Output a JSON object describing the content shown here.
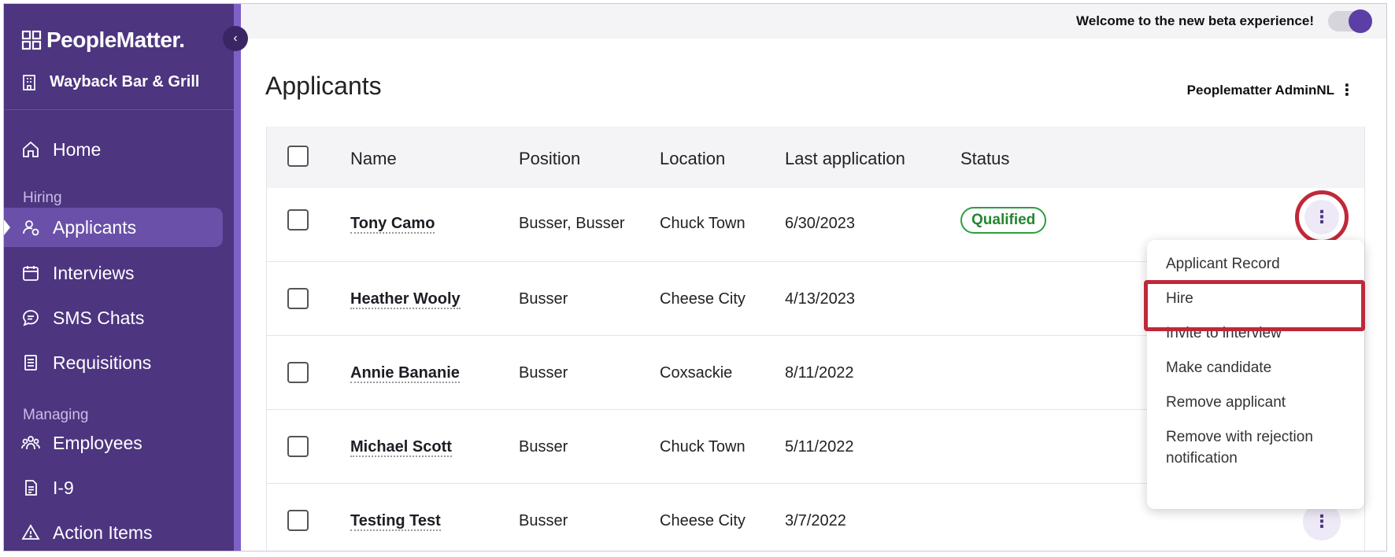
{
  "brand": {
    "name": "PeopleMatter."
  },
  "location": {
    "name": "Wayback Bar & Grill"
  },
  "nav": {
    "home": "Home",
    "section_hiring": "Hiring",
    "applicants": "Applicants",
    "interviews": "Interviews",
    "sms_chats": "SMS Chats",
    "requisitions": "Requisitions",
    "section_managing": "Managing",
    "employees": "Employees",
    "i9": "I-9",
    "action_items": "Action Items"
  },
  "beta": {
    "text": "Welcome to the new beta experience!",
    "enabled": true
  },
  "header": {
    "title": "Applicants",
    "user": "Peoplematter AdminNL"
  },
  "table": {
    "columns": [
      "Name",
      "Position",
      "Location",
      "Last application",
      "Status"
    ],
    "rows": [
      {
        "name": "Tony Camo",
        "position": "Busser, Busser",
        "location": "Chuck Town",
        "last_application": "6/30/2023",
        "status": "Qualified"
      },
      {
        "name": "Heather Wooly",
        "position": "Busser",
        "location": "Cheese City",
        "last_application": "4/13/2023",
        "status": ""
      },
      {
        "name": "Annie Bananie",
        "position": "Busser",
        "location": "Coxsackie",
        "last_application": "8/11/2022",
        "status": ""
      },
      {
        "name": "Michael Scott",
        "position": "Busser",
        "location": "Chuck Town",
        "last_application": "5/11/2022",
        "status": ""
      },
      {
        "name": "Testing Test",
        "position": "Busser",
        "location": "Cheese City",
        "last_application": "3/7/2022",
        "status": ""
      }
    ]
  },
  "menu": {
    "items": [
      "Applicant Record",
      "Hire",
      "Invite to interview",
      "Make candidate",
      "Remove applicant",
      "Remove with rejection notification"
    ]
  },
  "colors": {
    "sidebar": "#4d3580",
    "accent": "#5b3fa6",
    "highlight": "#c0283a",
    "qualified": "#2e9d3e"
  }
}
